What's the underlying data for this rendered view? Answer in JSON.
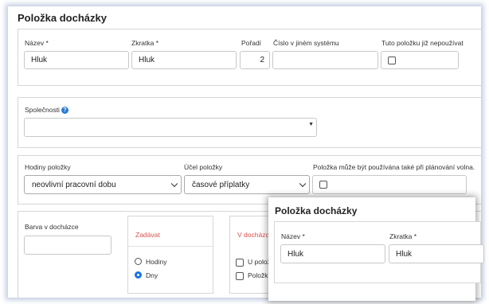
{
  "title": "Položka docházky",
  "row1": {
    "nazev": {
      "label": "Název *",
      "value": "Hluk"
    },
    "zkratka": {
      "label": "Zkratka *",
      "value": "Hluk"
    },
    "poradi": {
      "label": "Pořadí",
      "value": "2"
    },
    "cislo": {
      "label": "Číslo v jiném systému",
      "value": ""
    },
    "nepouzivat": {
      "label": "Tuto položku již nepoužívat",
      "checked": false
    }
  },
  "spolecnosti": {
    "label": "Společnosti",
    "help": "?",
    "value": ""
  },
  "row3": {
    "hodiny": {
      "label": "Hodiny položky",
      "value": "neovlivní pracovní dobu"
    },
    "ucel": {
      "label": "Účel položky",
      "value": "časové příplatky"
    },
    "planovani": {
      "label": "Položka může být používána také při plánování volna.",
      "checked": false
    }
  },
  "row4": {
    "barva": {
      "label": "Barva v docházce",
      "value": ""
    },
    "zadavat": {
      "title": "Zadávat",
      "options": [
        "Hodiny",
        "Dny"
      ],
      "selected": "Dny"
    },
    "vdochazce": {
      "title": "V docházce",
      "items": [
        "U položi",
        "Položku"
      ]
    }
  },
  "overlay": {
    "title": "Položka docházky",
    "nazev": {
      "label": "Název *",
      "value": "Hluk"
    },
    "zkratka": {
      "label": "Zkratka *",
      "value": "Hluk"
    }
  },
  "colors": {
    "section_title": "#d9534f",
    "accent": "#1a73e8",
    "help": "#2b7bd3"
  }
}
